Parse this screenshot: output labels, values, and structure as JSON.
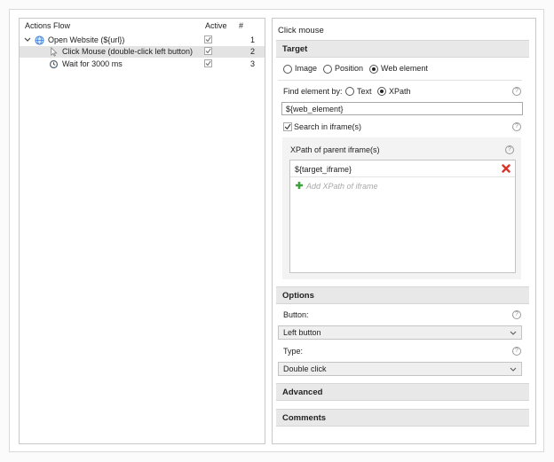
{
  "actions_flow": {
    "columns": [
      "Actions Flow",
      "Active",
      "#"
    ],
    "rows": [
      {
        "label": "Open Website (${url})",
        "active": true,
        "num": "1",
        "icon": "globe-icon"
      },
      {
        "label": "Click Mouse (double-click left button)",
        "active": true,
        "num": "2",
        "icon": "cursor-icon",
        "selected": true
      },
      {
        "label": "Wait for 3000 ms",
        "active": true,
        "num": "3",
        "icon": "clock-icon"
      }
    ]
  },
  "props": {
    "title": "Click mouse",
    "target": {
      "header": "Target",
      "modes": [
        "Image",
        "Position",
        "Web element"
      ],
      "selected_mode": "Web element",
      "find_by_label": "Find element by:",
      "find_by_options": [
        "Text",
        "XPath"
      ],
      "find_by_selected": "XPath",
      "element_value": "${web_element}",
      "search_iframe_label": "Search in iframe(s)",
      "search_iframe_checked": true,
      "iframe_xpath_label": "XPath of parent iframe(s)",
      "iframe_xpaths": [
        "${target_iframe}"
      ],
      "add_placeholder": "Add XPath of iframe"
    },
    "options": {
      "header": "Options",
      "button_label": "Button:",
      "button_value": "Left button",
      "type_label": "Type:",
      "type_value": "Double click"
    },
    "advanced": {
      "header": "Advanced"
    },
    "comments": {
      "header": "Comments"
    },
    "help_glyph": "?"
  },
  "colors": {
    "section_bg": "#e8e8e8",
    "selected_row": "#e3e3e3",
    "delete_red": "#d9342b",
    "add_green": "#3ea33e",
    "globe_blue": "#3a7bd5"
  }
}
